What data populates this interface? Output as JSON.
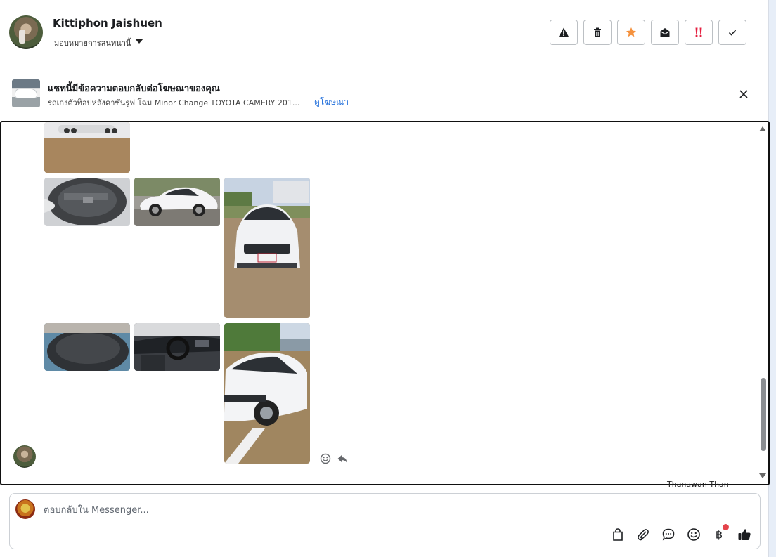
{
  "header": {
    "contact_name": "Kittiphon Jaishuen",
    "assign_label": "มอบหมายการสนทนานี้",
    "actions": [
      {
        "name": "report-spam-button",
        "icon": "warning-icon"
      },
      {
        "name": "delete-button",
        "icon": "trash-icon"
      },
      {
        "name": "star-button",
        "icon": "star-icon"
      },
      {
        "name": "mark-unread-button",
        "icon": "envelope-open-icon"
      },
      {
        "name": "follow-up-button",
        "icon": "double-exclamation-icon"
      },
      {
        "name": "mark-done-button",
        "icon": "checkmark-icon"
      }
    ]
  },
  "banner": {
    "title": "แชทนี้มีข้อความตอบกลับต่อโฆษณาของคุณ",
    "subtitle": "รถเก๋งตัวท็อปหลังคาซันรูฟ โฉม Minor Change TOYOTA CAMERY 201...",
    "link": "ดูโฆษณา"
  },
  "chat": {
    "cutoff_sender": "Thanawan Than"
  },
  "composer": {
    "placeholder": "ตอบกลับใน Messenger..."
  },
  "colors": {
    "accent_link": "#216fdb",
    "star": "#f5923e",
    "follow_up": "#e41e3f",
    "notification_dot": "#e4434b"
  }
}
